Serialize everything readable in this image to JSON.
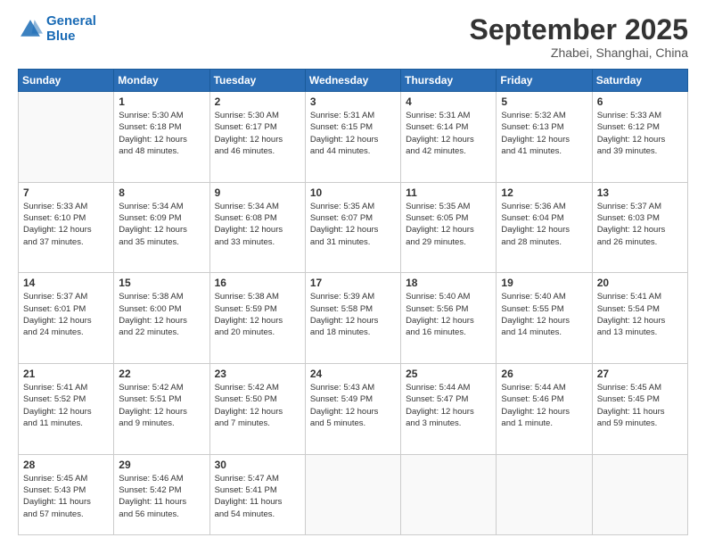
{
  "logo": {
    "line1": "General",
    "line2": "Blue"
  },
  "title": "September 2025",
  "location": "Zhabei, Shanghai, China",
  "days_header": [
    "Sunday",
    "Monday",
    "Tuesday",
    "Wednesday",
    "Thursday",
    "Friday",
    "Saturday"
  ],
  "weeks": [
    [
      {
        "day": "",
        "info": ""
      },
      {
        "day": "1",
        "info": "Sunrise: 5:30 AM\nSunset: 6:18 PM\nDaylight: 12 hours\nand 48 minutes."
      },
      {
        "day": "2",
        "info": "Sunrise: 5:30 AM\nSunset: 6:17 PM\nDaylight: 12 hours\nand 46 minutes."
      },
      {
        "day": "3",
        "info": "Sunrise: 5:31 AM\nSunset: 6:15 PM\nDaylight: 12 hours\nand 44 minutes."
      },
      {
        "day": "4",
        "info": "Sunrise: 5:31 AM\nSunset: 6:14 PM\nDaylight: 12 hours\nand 42 minutes."
      },
      {
        "day": "5",
        "info": "Sunrise: 5:32 AM\nSunset: 6:13 PM\nDaylight: 12 hours\nand 41 minutes."
      },
      {
        "day": "6",
        "info": "Sunrise: 5:33 AM\nSunset: 6:12 PM\nDaylight: 12 hours\nand 39 minutes."
      }
    ],
    [
      {
        "day": "7",
        "info": "Sunrise: 5:33 AM\nSunset: 6:10 PM\nDaylight: 12 hours\nand 37 minutes."
      },
      {
        "day": "8",
        "info": "Sunrise: 5:34 AM\nSunset: 6:09 PM\nDaylight: 12 hours\nand 35 minutes."
      },
      {
        "day": "9",
        "info": "Sunrise: 5:34 AM\nSunset: 6:08 PM\nDaylight: 12 hours\nand 33 minutes."
      },
      {
        "day": "10",
        "info": "Sunrise: 5:35 AM\nSunset: 6:07 PM\nDaylight: 12 hours\nand 31 minutes."
      },
      {
        "day": "11",
        "info": "Sunrise: 5:35 AM\nSunset: 6:05 PM\nDaylight: 12 hours\nand 29 minutes."
      },
      {
        "day": "12",
        "info": "Sunrise: 5:36 AM\nSunset: 6:04 PM\nDaylight: 12 hours\nand 28 minutes."
      },
      {
        "day": "13",
        "info": "Sunrise: 5:37 AM\nSunset: 6:03 PM\nDaylight: 12 hours\nand 26 minutes."
      }
    ],
    [
      {
        "day": "14",
        "info": "Sunrise: 5:37 AM\nSunset: 6:01 PM\nDaylight: 12 hours\nand 24 minutes."
      },
      {
        "day": "15",
        "info": "Sunrise: 5:38 AM\nSunset: 6:00 PM\nDaylight: 12 hours\nand 22 minutes."
      },
      {
        "day": "16",
        "info": "Sunrise: 5:38 AM\nSunset: 5:59 PM\nDaylight: 12 hours\nand 20 minutes."
      },
      {
        "day": "17",
        "info": "Sunrise: 5:39 AM\nSunset: 5:58 PM\nDaylight: 12 hours\nand 18 minutes."
      },
      {
        "day": "18",
        "info": "Sunrise: 5:40 AM\nSunset: 5:56 PM\nDaylight: 12 hours\nand 16 minutes."
      },
      {
        "day": "19",
        "info": "Sunrise: 5:40 AM\nSunset: 5:55 PM\nDaylight: 12 hours\nand 14 minutes."
      },
      {
        "day": "20",
        "info": "Sunrise: 5:41 AM\nSunset: 5:54 PM\nDaylight: 12 hours\nand 13 minutes."
      }
    ],
    [
      {
        "day": "21",
        "info": "Sunrise: 5:41 AM\nSunset: 5:52 PM\nDaylight: 12 hours\nand 11 minutes."
      },
      {
        "day": "22",
        "info": "Sunrise: 5:42 AM\nSunset: 5:51 PM\nDaylight: 12 hours\nand 9 minutes."
      },
      {
        "day": "23",
        "info": "Sunrise: 5:42 AM\nSunset: 5:50 PM\nDaylight: 12 hours\nand 7 minutes."
      },
      {
        "day": "24",
        "info": "Sunrise: 5:43 AM\nSunset: 5:49 PM\nDaylight: 12 hours\nand 5 minutes."
      },
      {
        "day": "25",
        "info": "Sunrise: 5:44 AM\nSunset: 5:47 PM\nDaylight: 12 hours\nand 3 minutes."
      },
      {
        "day": "26",
        "info": "Sunrise: 5:44 AM\nSunset: 5:46 PM\nDaylight: 12 hours\nand 1 minute."
      },
      {
        "day": "27",
        "info": "Sunrise: 5:45 AM\nSunset: 5:45 PM\nDaylight: 11 hours\nand 59 minutes."
      }
    ],
    [
      {
        "day": "28",
        "info": "Sunrise: 5:45 AM\nSunset: 5:43 PM\nDaylight: 11 hours\nand 57 minutes."
      },
      {
        "day": "29",
        "info": "Sunrise: 5:46 AM\nSunset: 5:42 PM\nDaylight: 11 hours\nand 56 minutes."
      },
      {
        "day": "30",
        "info": "Sunrise: 5:47 AM\nSunset: 5:41 PM\nDaylight: 11 hours\nand 54 minutes."
      },
      {
        "day": "",
        "info": ""
      },
      {
        "day": "",
        "info": ""
      },
      {
        "day": "",
        "info": ""
      },
      {
        "day": "",
        "info": ""
      }
    ]
  ]
}
